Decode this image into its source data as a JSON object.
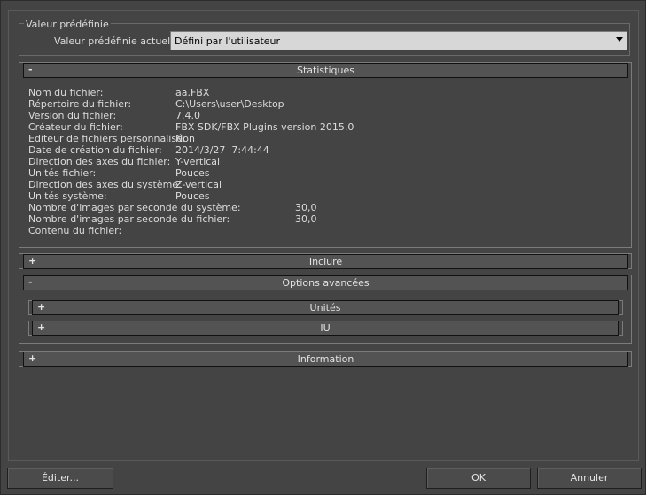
{
  "preset": {
    "group_title": "Valeur prédéfinie",
    "current_label": "Valeur prédéfinie actuelle:",
    "current_value": "Défini par l'utilisateur"
  },
  "statistics": {
    "toggle": "-",
    "title": "Statistiques",
    "rows": [
      {
        "label": "Nom du fichier:",
        "value": "aa.FBX"
      },
      {
        "label": "Répertoire du fichier:",
        "value": "C:\\Users\\user\\Desktop"
      },
      {
        "label": "Version du fichier:",
        "value": "7.4.0"
      },
      {
        "label": "Créateur du fichier:",
        "value": "FBX SDK/FBX Plugins version 2015.0"
      },
      {
        "label": "Editeur de fichiers personnalisé:",
        "value": "Non"
      },
      {
        "label": "Date de création du fichier:",
        "value": "2014/3/27  7:44:44"
      },
      {
        "label": "Direction des axes du fichier:",
        "value": "Y-vertical"
      },
      {
        "label": "Unités fichier:",
        "value": "Pouces"
      },
      {
        "label": "Direction des axes du système:",
        "value": "Z-vertical"
      },
      {
        "label": "Unités système:",
        "value": "Pouces"
      },
      {
        "label": "Nombre d'images par seconde du système:",
        "value": "30,0"
      },
      {
        "label": "Nombre d'images par seconde du fichier:",
        "value": "30,0"
      },
      {
        "label": "Contenu du fichier:",
        "value": ""
      }
    ]
  },
  "include": {
    "toggle": "+",
    "title": "Inclure"
  },
  "advanced": {
    "toggle": "-",
    "title": "Options avancées",
    "subpanels": [
      {
        "toggle": "+",
        "title": "Unités"
      },
      {
        "toggle": "+",
        "title": "IU"
      }
    ]
  },
  "information": {
    "toggle": "+",
    "title": "Information"
  },
  "buttons": {
    "edit": "Éditer...",
    "ok": "OK",
    "cancel": "Annuler"
  }
}
